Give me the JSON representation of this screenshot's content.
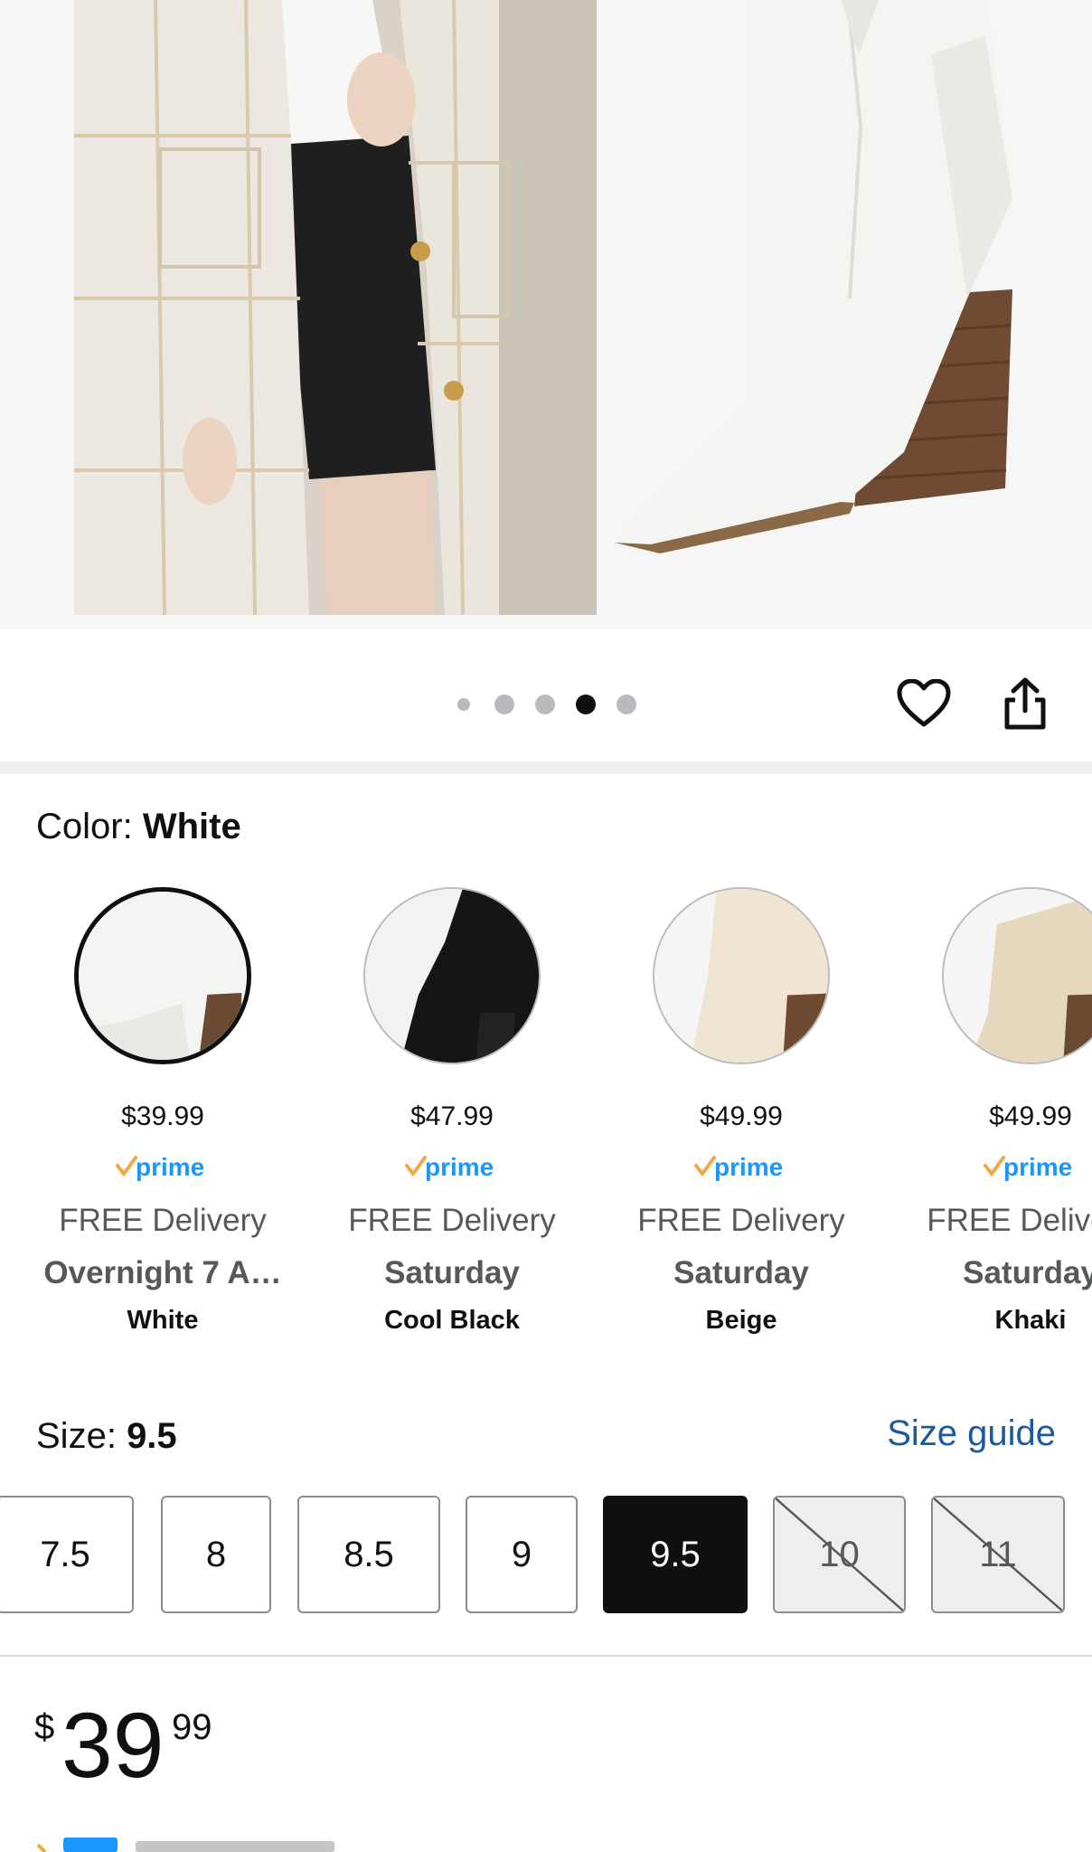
{
  "gallery": {
    "dot_count": 5,
    "active_dot": 4,
    "wishlist_icon": "heart-icon",
    "share_icon": "share-icon"
  },
  "color": {
    "label": "Color:",
    "selected": "White",
    "options": [
      {
        "price": "$39.99",
        "delivery": "FREE Delivery",
        "date": "Overnight 7 A…",
        "name": "White",
        "swatch": "#f4f4f2",
        "heel": "#6b4a34",
        "selected": true
      },
      {
        "price": "$47.99",
        "delivery": "FREE Delivery",
        "date": "Saturday",
        "name": "Cool Black",
        "swatch": "#151515",
        "heel": "#222222",
        "selected": false
      },
      {
        "price": "$49.99",
        "delivery": "FREE Delivery",
        "date": "Saturday",
        "name": "Beige",
        "swatch": "#f0e4d3",
        "heel": "#6e4a30",
        "selected": false
      },
      {
        "price": "$49.99",
        "delivery": "FREE Delivery",
        "date": "Saturday",
        "name": "Khaki",
        "swatch": "#e6d7bf",
        "heel": "#6b4a34",
        "selected": false
      }
    ]
  },
  "size": {
    "label": "Size:",
    "selected": "9.5",
    "guide_link": "Size guide",
    "options": [
      {
        "label": "7.5",
        "state": "available"
      },
      {
        "label": "8",
        "state": "available"
      },
      {
        "label": "8.5",
        "state": "available"
      },
      {
        "label": "9",
        "state": "available"
      },
      {
        "label": "9.5",
        "state": "selected"
      },
      {
        "label": "10",
        "state": "unavailable"
      },
      {
        "label": "11",
        "state": "unavailable"
      }
    ]
  },
  "price": {
    "symbol": "$",
    "whole": "39",
    "fraction": "99"
  },
  "prime": {
    "label": "prime",
    "check_color": "#f3a847",
    "text_color": "#1a98ff"
  },
  "colors": {
    "link": "#1c5a9e",
    "text": "#0f1111",
    "muted": "#565959"
  }
}
